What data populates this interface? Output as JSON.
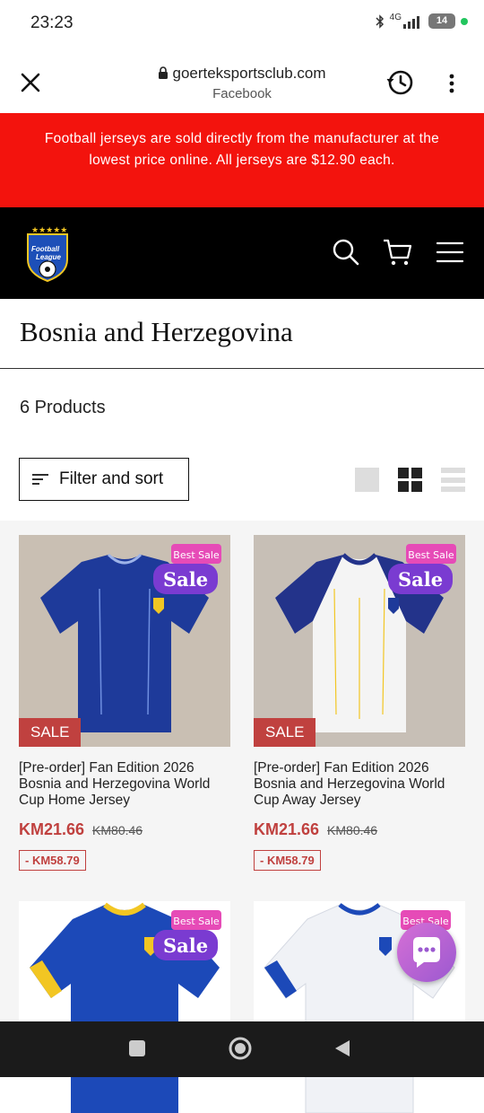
{
  "status_bar": {
    "time": "23:23",
    "network": "4G",
    "battery": "14"
  },
  "browser": {
    "url": "goerteksportsclub.com",
    "subtitle": "Facebook"
  },
  "announcement": "Football jerseys are sold directly from the manufacturer at the lowest price online. All jerseys are $12.90 each.",
  "logo": {
    "line1": "Football",
    "line2": "League"
  },
  "page_title": "Bosnia and Herzegovina",
  "product_count": "6 Products",
  "filter_label": "Filter and sort",
  "promo": {
    "best_sale": "Best Sale",
    "sale": "Sale"
  },
  "products": [
    {
      "name": "[Pre-order] Fan Edition 2026 Bosnia and Herzegovina World Cup Home Jersey",
      "price": "KM21.66",
      "old_price": "KM80.46",
      "discount": "- KM58.79",
      "badge": "SALE",
      "color": "#1e3a9a"
    },
    {
      "name": "[Pre-order] Fan Edition 2026 Bosnia and Herzegovina World Cup Away Jersey",
      "price": "KM21.66",
      "old_price": "KM80.46",
      "discount": "- KM58.79",
      "badge": "SALE",
      "color": "#f4f4f4"
    },
    {
      "color": "#1c49b8"
    },
    {
      "color": "#f4f4f4"
    }
  ],
  "colors": {
    "announce_bg": "#f3130d",
    "header_bg": "#000000",
    "sale_red": "#c0413f"
  }
}
